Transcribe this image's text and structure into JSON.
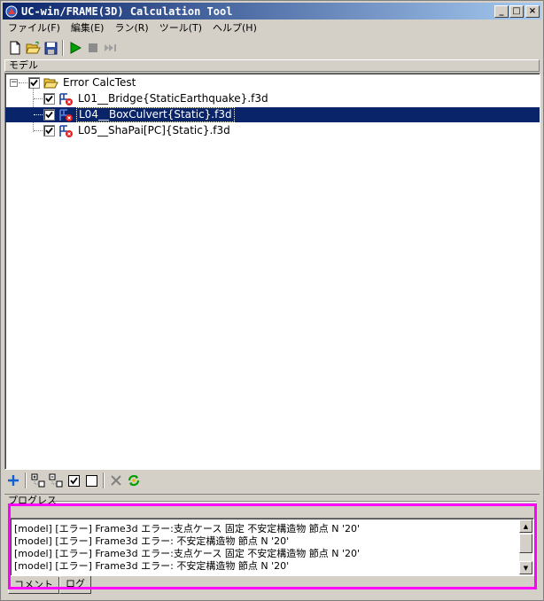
{
  "window": {
    "title": "UC-win/FRAME(3D) Calculation Tool",
    "minimize_glyph": "_",
    "maximize_glyph": "□",
    "close_glyph": "×"
  },
  "menu": {
    "items": [
      {
        "label": "ファイル(F)"
      },
      {
        "label": "編集(E)"
      },
      {
        "label": "ラン(R)"
      },
      {
        "label": "ツール(T)"
      },
      {
        "label": "ヘルプ(H)"
      }
    ]
  },
  "toolbar": {
    "icons": [
      "new-file-icon",
      "open-folder-icon",
      "save-icon",
      "run-icon",
      "stop-icon",
      "fast-forward-icon"
    ]
  },
  "model_panel": {
    "label": "モデル"
  },
  "tree": {
    "root": {
      "label": "Error CalcTest",
      "expander": "−",
      "checked": true
    },
    "items": [
      {
        "label": "L01__Bridge{StaticEarthquake}.f3d",
        "checked": true,
        "selected": false
      },
      {
        "label": "L04__BoxCulvert{Static}.f3d",
        "checked": true,
        "selected": true
      },
      {
        "label": "L05__ShaPai[PC]{Static}.f3d",
        "checked": true,
        "selected": false
      }
    ]
  },
  "bottom_toolbar": {
    "icons": [
      "add-icon",
      "expand-all-icon",
      "collapse-all-icon",
      "check-all-icon",
      "uncheck-all-icon",
      "delete-icon",
      "refresh-icon"
    ]
  },
  "progress": {
    "label": "プログレス"
  },
  "log": {
    "lines": [
      "[model] [エラー] Frame3d エラー:支点ケース 固定 不安定構造物  節点 N '20'",
      "[model] [エラー] Frame3d エラー: 不安定構造物  節点 N '20'",
      "[model] [エラー] Frame3d エラー:支点ケース 固定 不安定構造物  節点 N '20'",
      "[model] [エラー] Frame3d エラー: 不安定構造物  節点 N '20'"
    ]
  },
  "tabs": [
    {
      "label": "コメント",
      "active": false
    },
    {
      "label": "ログ",
      "active": true
    }
  ],
  "colors": {
    "title_start": "#0a246a",
    "title_end": "#a6caf0",
    "selection": "#0a246a",
    "highlight": "#ff00ff",
    "run_green": "#00a000"
  }
}
